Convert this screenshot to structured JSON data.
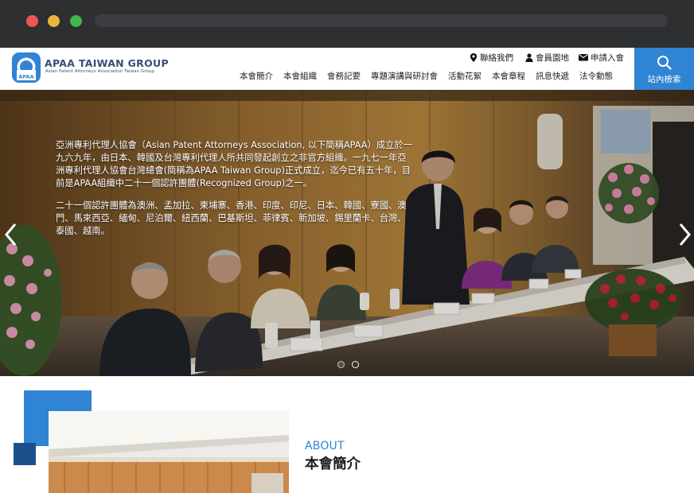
{
  "header": {
    "brand_title": "APAA TAIWAN GROUP",
    "brand_subtitle": "Asian Patent Attorneys Association Taiwan Group",
    "logo_text": "APAA",
    "accent_color": "#2f84d4"
  },
  "utility_links": {
    "contact": {
      "label": "聯絡我們",
      "icon": "map-pin-icon"
    },
    "member": {
      "label": "會員園地",
      "icon": "user-icon"
    },
    "join": {
      "label": "申請入會",
      "icon": "envelope-icon"
    }
  },
  "nav": {
    "items": [
      {
        "label": "本會簡介"
      },
      {
        "label": "本會組織"
      },
      {
        "label": "會務記要"
      },
      {
        "label": "專題演講與研討會"
      },
      {
        "label": "活動花絮"
      },
      {
        "label": "本會章程"
      },
      {
        "label": "訊息快遞"
      },
      {
        "label": "法令動態"
      }
    ]
  },
  "search": {
    "label": "站內檢索",
    "icon": "search-icon"
  },
  "hero": {
    "paragraph1": "亞洲專利代理人協會（Asian Patent Attorneys Association, 以下簡稱APAA）成立於一九六九年，由日本、韓國及台灣專利代理人所共同發起創立之非官方組織。一九七一年亞洲專利代理人協會台灣總會(簡稱為APAA Taiwan Group)正式成立，迄今已有五十年，目前是APAA組織中二十一個認許團體(Recognized Group)之一。",
    "paragraph2": "二十一個認許團體為澳洲、孟加拉、柬埔寨、香港、印度、印尼、日本、韓國、寮國、澳門、馬來西亞、緬甸、尼泊爾、紐西蘭、巴基斯坦、菲律賓、新加坡、錫里蘭卡、台灣、泰國、越南。",
    "slide_count": 2,
    "active_slide": 2
  },
  "about": {
    "kicker": "ABOUT",
    "title": "本會簡介"
  }
}
